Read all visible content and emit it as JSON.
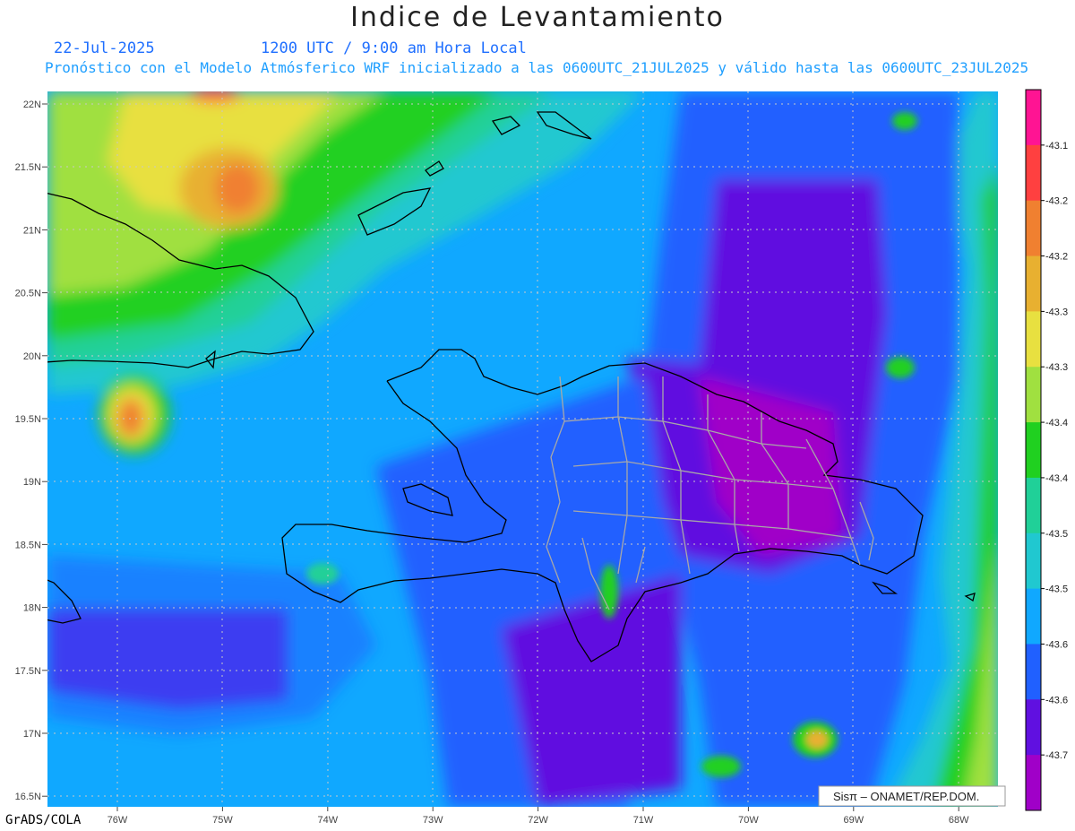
{
  "header": {
    "title": "Indice de Levantamiento",
    "date": "22-Jul-2025",
    "time": "1200 UTC / 9:00 am Hora Local",
    "description": "Pronóstico con el Modelo Atmósferico WRF inicializado a las 0600UTC_21JUL2025 y válido hasta las  0600UTC_23JUL2025"
  },
  "map": {
    "lat_labels": [
      "22N",
      "21.5N",
      "21N",
      "20.5N",
      "20N",
      "19.5N",
      "19N",
      "18.5N",
      "18N",
      "17.5N",
      "17N",
      "16.5N"
    ],
    "lon_labels": [
      "76W",
      "75W",
      "74W",
      "73W",
      "72W",
      "71W",
      "70W",
      "69W",
      "68W"
    ],
    "lat_range": [
      16.4,
      22.1
    ],
    "lon_range": [
      -76.7,
      -67.6
    ],
    "watermark": "Sisπ – ONAMET/REP.DOM."
  },
  "colorbar": {
    "labels": [
      "-43.1",
      "-43.2",
      "-43.2",
      "-43.3",
      "-43.3",
      "-43.4",
      "-43.4",
      "-43.5",
      "-43.5",
      "-43.6",
      "-43.6",
      "-43.7"
    ],
    "colors": [
      "#ff1493",
      "#ff4040",
      "#f08030",
      "#e8b030",
      "#e8e040",
      "#a0e040",
      "#20d020",
      "#20d098",
      "#20c8d0",
      "#10a8ff",
      "#2060ff",
      "#6010e0",
      "#a000c8"
    ]
  },
  "footer": {
    "credit": "GrADS/COLA"
  }
}
